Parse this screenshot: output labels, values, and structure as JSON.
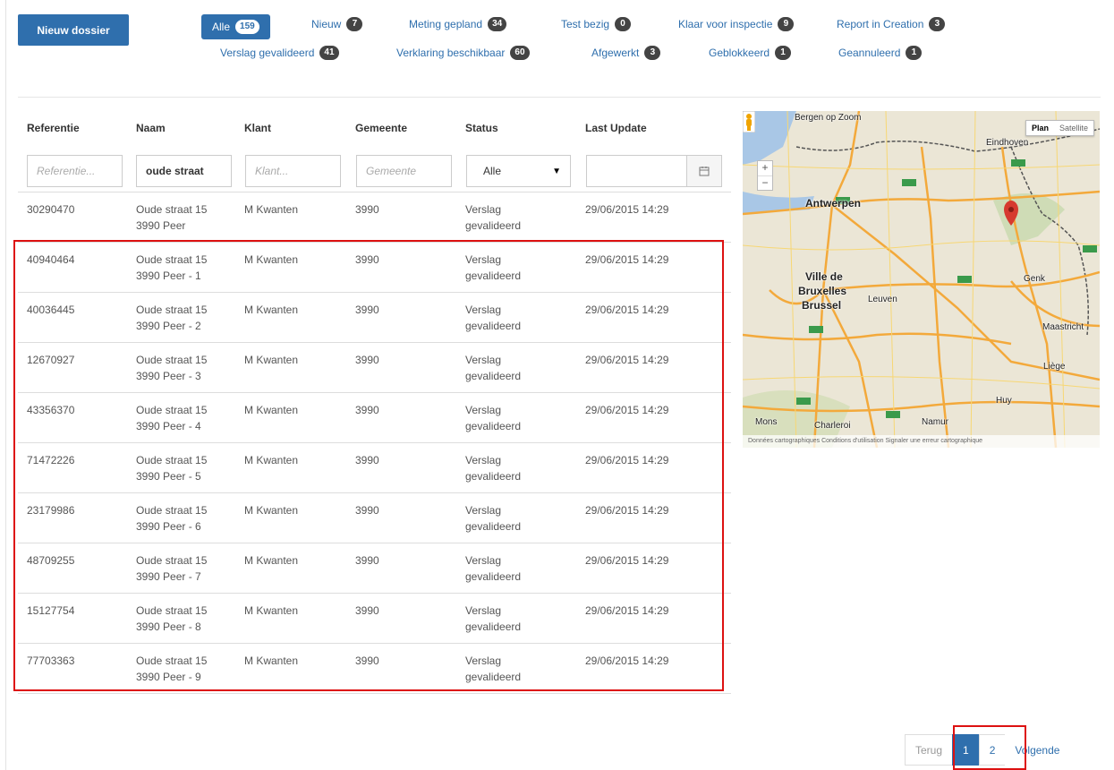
{
  "toolbar": {
    "new_label": "Nieuw dossier"
  },
  "filters": [
    {
      "label": "Alle",
      "count": "159"
    },
    {
      "label": "Nieuw",
      "count": "7"
    },
    {
      "label": "Meting gepland",
      "count": "34"
    },
    {
      "label": "Test bezig",
      "count": "0"
    },
    {
      "label": "Klaar voor inspectie",
      "count": "9"
    },
    {
      "label": "Report in Creation",
      "count": "3"
    },
    {
      "label": "Verslag gevalideerd",
      "count": "41"
    },
    {
      "label": "Verklaring beschikbaar",
      "count": "60"
    },
    {
      "label": "Afgewerkt",
      "count": "3"
    },
    {
      "label": "Geblokkeerd",
      "count": "1"
    },
    {
      "label": "Geannuleerd",
      "count": "1"
    }
  ],
  "table": {
    "headers": [
      "Referentie",
      "Naam",
      "Klant",
      "Gemeente",
      "Status",
      "Last Update"
    ],
    "filters": {
      "ref_placeholder": "Referentie...",
      "naam_value": "oude straat",
      "klant_placeholder": "Klant...",
      "gemeente_placeholder": "Gemeente",
      "status_value": "Alle",
      "date_value": ""
    },
    "rows": [
      {
        "ref": "30290470",
        "naam1": "Oude straat 15",
        "naam2": "3990 Peer",
        "klant": "M Kwanten",
        "gemeente": "3990",
        "status1": "Verslag",
        "status2": "gevalideerd",
        "updated": "29/06/2015 14:29"
      },
      {
        "ref": "40940464",
        "naam1": "Oude straat 15",
        "naam2": "3990 Peer - 1",
        "klant": "M Kwanten",
        "gemeente": "3990",
        "status1": "Verslag",
        "status2": "gevalideerd",
        "updated": "29/06/2015 14:29"
      },
      {
        "ref": "40036445",
        "naam1": "Oude straat 15",
        "naam2": "3990 Peer - 2",
        "klant": "M Kwanten",
        "gemeente": "3990",
        "status1": "Verslag",
        "status2": "gevalideerd",
        "updated": "29/06/2015 14:29"
      },
      {
        "ref": "12670927",
        "naam1": "Oude straat 15",
        "naam2": "3990 Peer - 3",
        "klant": "M Kwanten",
        "gemeente": "3990",
        "status1": "Verslag",
        "status2": "gevalideerd",
        "updated": "29/06/2015 14:29"
      },
      {
        "ref": "43356370",
        "naam1": "Oude straat 15",
        "naam2": "3990 Peer - 4",
        "klant": "M Kwanten",
        "gemeente": "3990",
        "status1": "Verslag",
        "status2": "gevalideerd",
        "updated": "29/06/2015 14:29"
      },
      {
        "ref": "71472226",
        "naam1": "Oude straat 15",
        "naam2": "3990 Peer - 5",
        "klant": "M Kwanten",
        "gemeente": "3990",
        "status1": "Verslag",
        "status2": "gevalideerd",
        "updated": "29/06/2015 14:29"
      },
      {
        "ref": "23179986",
        "naam1": "Oude straat 15",
        "naam2": "3990 Peer - 6",
        "klant": "M Kwanten",
        "gemeente": "3990",
        "status1": "Verslag",
        "status2": "gevalideerd",
        "updated": "29/06/2015 14:29"
      },
      {
        "ref": "48709255",
        "naam1": "Oude straat 15",
        "naam2": "3990 Peer - 7",
        "klant": "M Kwanten",
        "gemeente": "3990",
        "status1": "Verslag",
        "status2": "gevalideerd",
        "updated": "29/06/2015 14:29"
      },
      {
        "ref": "15127754",
        "naam1": "Oude straat 15",
        "naam2": "3990 Peer - 8",
        "klant": "M Kwanten",
        "gemeente": "3990",
        "status1": "Verslag",
        "status2": "gevalideerd",
        "updated": "29/06/2015 14:29"
      },
      {
        "ref": "77703363",
        "naam1": "Oude straat 15",
        "naam2": "3990 Peer - 9",
        "klant": "M Kwanten",
        "gemeente": "3990",
        "status1": "Verslag",
        "status2": "gevalideerd",
        "updated": "29/06/2015 14:29"
      }
    ]
  },
  "map": {
    "type_plan": "Plan",
    "type_satellite": "Satellite",
    "zoom_in": "+",
    "zoom_out": "−",
    "labels": {
      "bergen": "Bergen op Zoom",
      "eindhoven": "Eindhoven",
      "antwerpen": "Antwerpen",
      "bruxelles1": "Ville de",
      "bruxelles2": "Bruxelles",
      "bruxelles3": "Brussel",
      "leuven": "Leuven",
      "genk": "Genk",
      "maastricht": "Maastricht",
      "liege": "Liège",
      "huy": "Huy",
      "namur": "Namur",
      "charleroi": "Charleroi",
      "mons": "Mons"
    },
    "footer": "Données cartographiques   Conditions d'utilisation   Signaler une erreur cartographique"
  },
  "pagination": {
    "prev": "Terug",
    "pages": [
      "1",
      "2"
    ],
    "next": "Volgende"
  },
  "colors": {
    "accent": "#2f6fad",
    "highlight": "#dd1111"
  }
}
